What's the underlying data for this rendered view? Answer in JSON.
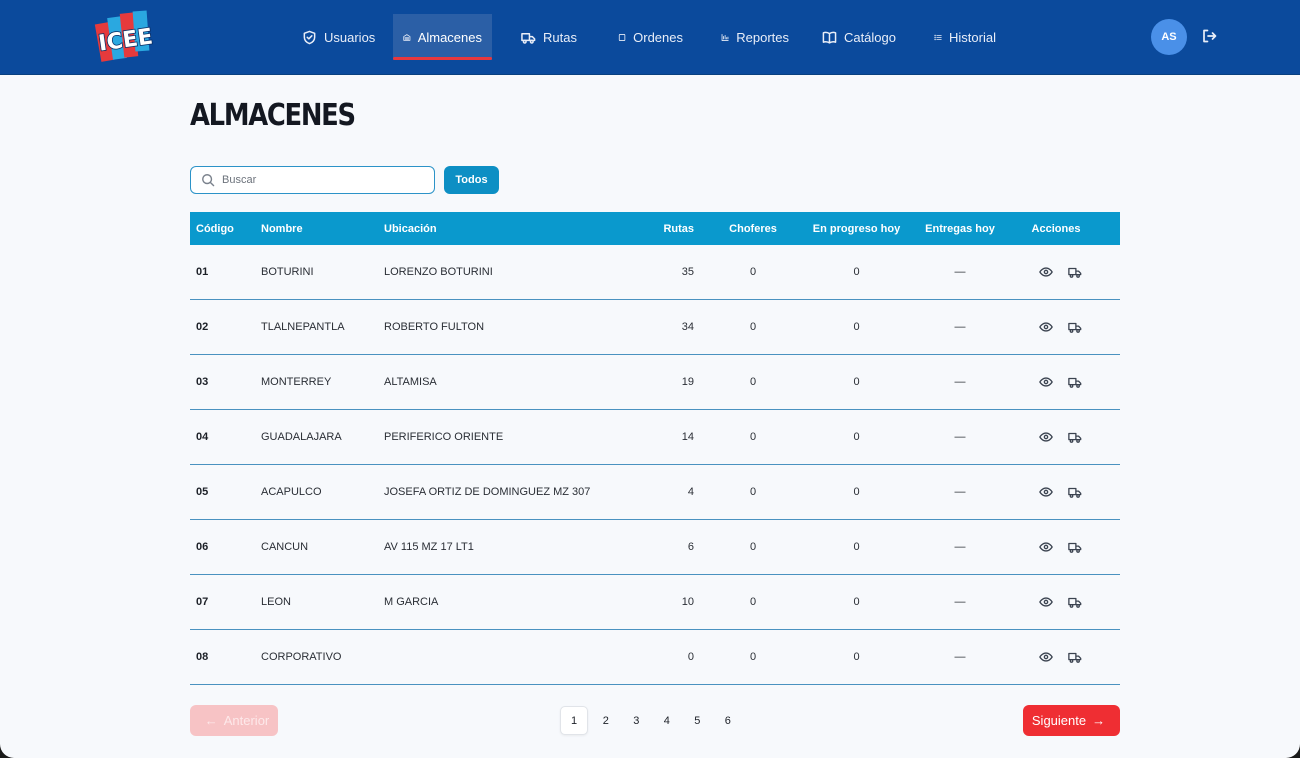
{
  "header": {
    "logo_text": "ICEE",
    "nav": [
      {
        "label": "Usuarios",
        "icon": "shield-icon",
        "active": false
      },
      {
        "label": "Almacenes",
        "icon": "warehouse-icon",
        "active": true
      },
      {
        "label": "Rutas",
        "icon": "truck-icon",
        "active": false
      },
      {
        "label": "Ordenes",
        "icon": "square-icon",
        "active": false
      },
      {
        "label": "Reportes",
        "icon": "bar-chart-icon",
        "active": false
      },
      {
        "label": "Catálogo",
        "icon": "book-icon",
        "active": false
      },
      {
        "label": "Historial",
        "icon": "list-icon",
        "active": false
      }
    ],
    "avatar_initials": "AS"
  },
  "page": {
    "title": "ALMACENES",
    "search_placeholder": "Buscar",
    "filter_label": "Todos"
  },
  "table": {
    "columns": [
      "Código",
      "Nombre",
      "Ubicación",
      "Rutas",
      "Choferes",
      "En progreso hoy",
      "Entregas hoy",
      "Acciones"
    ],
    "rows": [
      {
        "code": "01",
        "name": "BOTURINI",
        "location": "LORENZO BOTURINI",
        "rutas": "35",
        "choferes": "0",
        "progreso": "0",
        "entregas": "—"
      },
      {
        "code": "02",
        "name": "TLALNEPANTLA",
        "location": "ROBERTO FULTON",
        "rutas": "34",
        "choferes": "0",
        "progreso": "0",
        "entregas": "—"
      },
      {
        "code": "03",
        "name": "MONTERREY",
        "location": "ALTAMISA",
        "rutas": "19",
        "choferes": "0",
        "progreso": "0",
        "entregas": "—"
      },
      {
        "code": "04",
        "name": "GUADALAJARA",
        "location": "PERIFERICO ORIENTE",
        "rutas": "14",
        "choferes": "0",
        "progreso": "0",
        "entregas": "—"
      },
      {
        "code": "05",
        "name": "ACAPULCO",
        "location": "JOSEFA ORTIZ DE DOMINGUEZ MZ 307",
        "rutas": "4",
        "choferes": "0",
        "progreso": "0",
        "entregas": "—"
      },
      {
        "code": "06",
        "name": "CANCUN",
        "location": "AV 115 MZ 17 LT1",
        "rutas": "6",
        "choferes": "0",
        "progreso": "0",
        "entregas": "—"
      },
      {
        "code": "07",
        "name": "LEON",
        "location": "M GARCIA",
        "rutas": "10",
        "choferes": "0",
        "progreso": "0",
        "entregas": "—"
      },
      {
        "code": "08",
        "name": "CORPORATIVO",
        "location": "",
        "rutas": "0",
        "choferes": "0",
        "progreso": "0",
        "entregas": "—"
      }
    ]
  },
  "pagination": {
    "prev_label": "Anterior",
    "next_label": "Siguiente",
    "pages": [
      "1",
      "2",
      "3",
      "4",
      "5",
      "6"
    ],
    "current_page": "1"
  },
  "colors": {
    "header_bg": "#0b4a9c",
    "table_header_bg": "#0a99cd",
    "accent_red": "#ef2e33",
    "active_underline": "#e8383d"
  }
}
